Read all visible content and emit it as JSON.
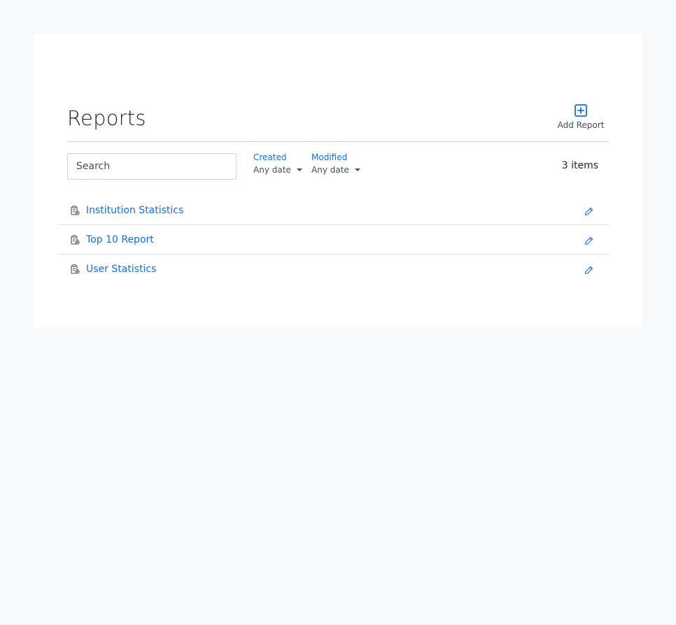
{
  "page": {
    "title": "Reports"
  },
  "toolbar": {
    "add_label": "Add Report"
  },
  "search": {
    "placeholder": "Search"
  },
  "filters": [
    {
      "label": "Created",
      "value": "Any date"
    },
    {
      "label": "Modified",
      "value": "Any date"
    }
  ],
  "summary": {
    "count_text": "3 items"
  },
  "reports": [
    {
      "name": "Institution Statistics"
    },
    {
      "name": "Top 10 Report"
    },
    {
      "name": "User Statistics"
    }
  ],
  "icons": {
    "add": "plus-square-icon",
    "report": "clipboard-data-icon",
    "edit": "pencil-icon"
  },
  "colors": {
    "accent": "#0d6efd",
    "background": "#f8f9fa",
    "card": "#ffffff",
    "muted": "#495057"
  }
}
